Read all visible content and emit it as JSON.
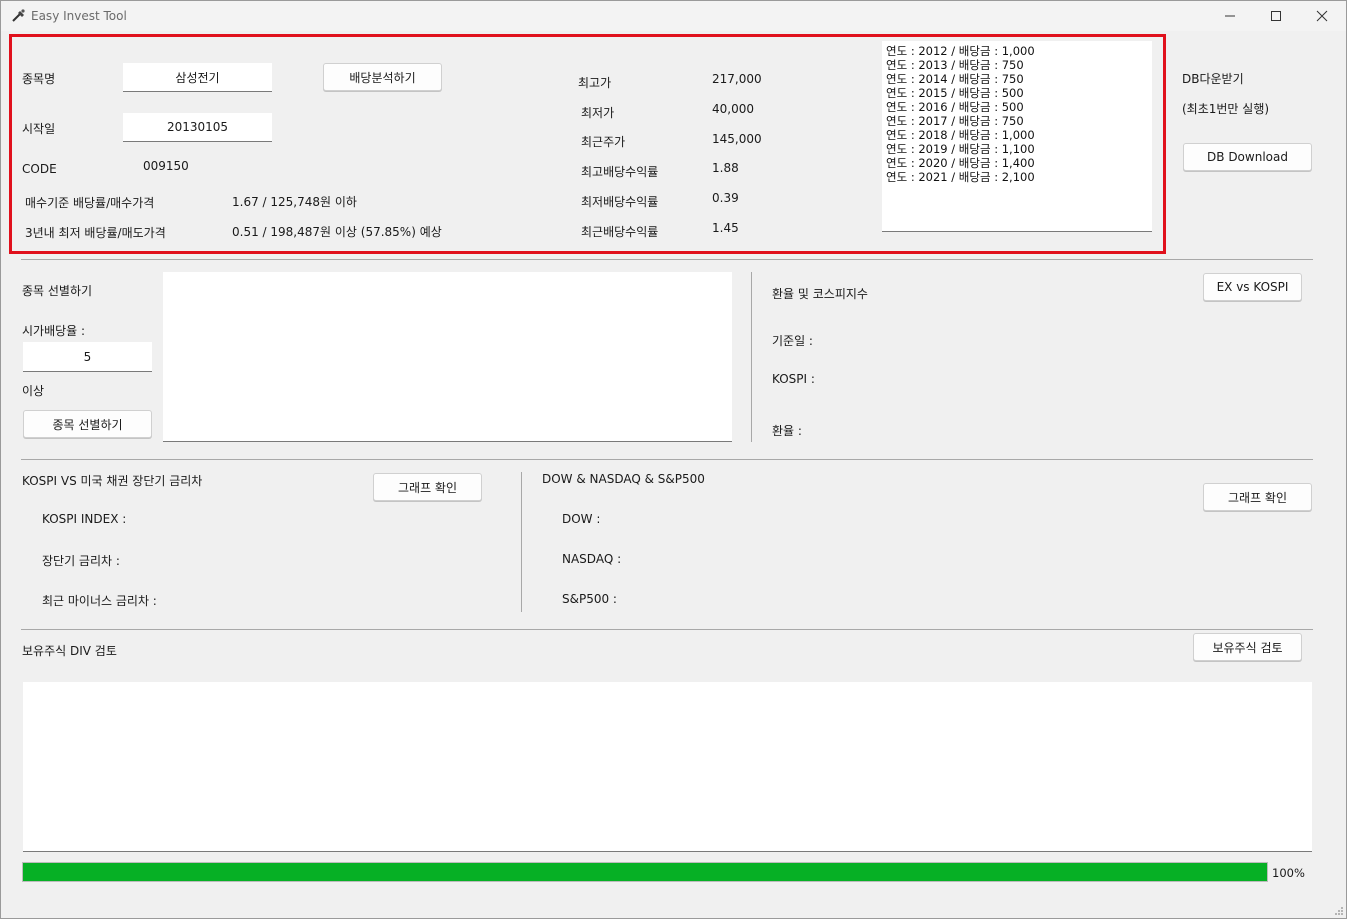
{
  "window": {
    "title": "Easy Invest Tool",
    "minimize": "—",
    "maximize": "☐",
    "close": "✕"
  },
  "dividend": {
    "stock_name_label": "종목명",
    "stock_name_value": "삼성전기",
    "analyze_button": "배당분석하기",
    "start_date_label": "시작일",
    "start_date_value": "20130105",
    "code_label": "CODE",
    "code_value": "009150",
    "buy_label": "매수기준 배당률/매수가격",
    "buy_value": "1.67 / 125,748원 이하",
    "sell_label": "3년내 최저 배당률/매도가격",
    "sell_value": "0.51 / 198,487원 이상 (57.85%) 예상",
    "high_price_label": "최고가",
    "high_price_value": "217,000",
    "low_price_label": "최저가",
    "low_price_value": "40,000",
    "recent_price_label": "최근주가",
    "recent_price_value": "145,000",
    "max_yield_label": "최고배당수익률",
    "max_yield_value": "1.88",
    "min_yield_label": "최저배당수익률",
    "min_yield_value": "0.39",
    "recent_yield_label": "최근배당수익률",
    "recent_yield_value": "1.45",
    "history": [
      "연도 : 2012 / 배당금 : 1,000",
      "연도 : 2013 / 배당금 : 750",
      "연도 : 2014 / 배당금 : 750",
      "연도 : 2015 / 배당금 : 500",
      "연도 : 2016 / 배당금 : 500",
      "연도 : 2017 / 배당금 : 750",
      "연도 : 2018 / 배당금 : 1,000",
      "연도 : 2019 / 배당금 : 1,100",
      "연도 : 2020 / 배당금 : 1,400",
      "연도 : 2021 / 배당금 : 2,100"
    ]
  },
  "db": {
    "label": "DB다운받기",
    "note": "(최초1번만 실행)",
    "button": "DB Download"
  },
  "screener": {
    "title": "종목 선별하기",
    "yield_label": "시가배당율 :",
    "yield_value": "5",
    "above_label": "이상",
    "button": "종목 선별하기"
  },
  "exchange": {
    "title": "환율 및 코스피지수",
    "button": "EX vs KOSPI",
    "base_date_label": "기준일 :",
    "kospi_label": "KOSPI :",
    "rate_label": "환율 :"
  },
  "bond": {
    "title": "KOSPI VS 미국 채권 장단기 금리차",
    "button": "그래프 확인",
    "kospi_index_label": "KOSPI INDEX :",
    "spread_label": "장단기 금리차 :",
    "minus_spread_label": "최근 마이너스 금리차 :"
  },
  "us_index": {
    "title": "DOW & NASDAQ & S&P500",
    "button": "그래프 확인",
    "dow_label": "DOW :",
    "nasdaq_label": "NASDAQ :",
    "sp500_label": "S&P500 :"
  },
  "holdings": {
    "title": "보유주식 DIV 검토",
    "button": "보유주식 검토"
  },
  "progress": {
    "value": 100,
    "label": "100%",
    "color": "#06b025"
  },
  "colors": {
    "highlight_frame": "#e0101c"
  }
}
